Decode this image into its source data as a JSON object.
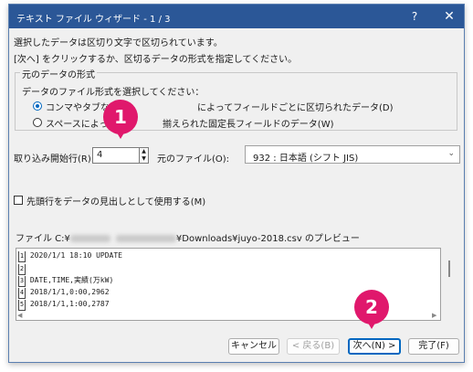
{
  "window": {
    "title": "テキスト ファイル ウィザード - 1 / 3",
    "help_label": "?",
    "close_label": "✕"
  },
  "intro": {
    "line1": "選択したデータは区切り文字で区切られています。",
    "line2": "[次へ] をクリックするか、区切るデータの形式を指定してください。"
  },
  "original_format": {
    "legend": "元のデータの形式",
    "prompt": "データのファイル形式を選択してください：",
    "option_delimited_before": "コンマやタブなどの",
    "option_delimited_after": "によってフィールドごとに区切られたデータ(D)",
    "option_fixed_before": "スペースによって右",
    "option_fixed_after": "揃えられた固定長フィールドのデータ(W)",
    "selected": "delimited"
  },
  "start_row": {
    "label": "取り込み開始行(R):",
    "value": "4"
  },
  "origin": {
    "label": "元のファイル(O):",
    "value": "932 : 日本語 (シフト JIS)"
  },
  "header_option": {
    "label": "先頭行をデータの見出しとして使用する(M)",
    "checked": false
  },
  "preview": {
    "label_prefix": "ファイル C:¥",
    "label_suffix": "¥Downloads¥juyo-2018.csv のプレビュー",
    "lines": [
      {
        "num": "1",
        "text": "2020/1/1 18:10 UPDATE"
      },
      {
        "num": "2",
        "text": ""
      },
      {
        "num": "3",
        "text": "DATE,TIME,実績(万kW)"
      },
      {
        "num": "4",
        "text": "2018/1/1,0:00,2962"
      },
      {
        "num": "5",
        "text": "2018/1/1,1:00,2787"
      }
    ]
  },
  "buttons": {
    "cancel": "キャンセル",
    "back": "< 戻る(B)",
    "next": "次へ(N) >",
    "finish": "完了(F)"
  },
  "callouts": {
    "first": "1",
    "second": "2"
  },
  "colors": {
    "titlebar": "#2b5797",
    "accent": "#0067c0",
    "callout": "#e0186c"
  }
}
